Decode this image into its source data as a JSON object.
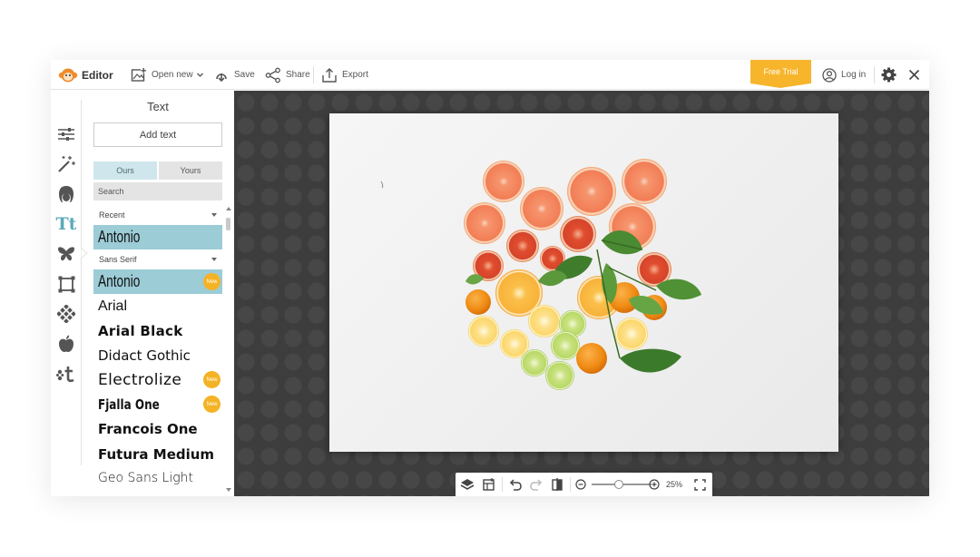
{
  "topbar": {
    "app_name": "Editor",
    "open_new": "Open new",
    "save": "Save",
    "share": "Share",
    "export": "Export",
    "free_trial": "Free Trial",
    "login": "Log in"
  },
  "rail": {
    "icons": [
      "sliders-icon",
      "magic-wand-icon",
      "face-icon",
      "text-icon",
      "butterfly-icon",
      "frame-icon",
      "texture-icon",
      "apple-icon",
      "sparkle-t-icon"
    ],
    "active": "text-icon",
    "text_glyph": "Tt"
  },
  "panel": {
    "title": "Text",
    "add_text": "Add text",
    "tabs": {
      "ours": "Ours",
      "yours": "Yours",
      "active": "Ours"
    },
    "search_placeholder": "Search",
    "recent_select": "Recent",
    "recent_fonts": [
      "Antonio"
    ],
    "category_select": "Sans Serif",
    "fonts": [
      {
        "name": "Antonio",
        "selected": true,
        "badge": "New"
      },
      {
        "name": "Arial",
        "selected": false
      },
      {
        "name": "Arial Black",
        "selected": false
      },
      {
        "name": "Didact Gothic",
        "selected": false
      },
      {
        "name": "Electrolize",
        "selected": false,
        "badge": "New"
      },
      {
        "name": "Fjalla One",
        "selected": false,
        "badge": "New"
      },
      {
        "name": "Francois One",
        "selected": false
      },
      {
        "name": "Futura Medium",
        "selected": false
      },
      {
        "name": "Geo Sans Light",
        "selected": false
      }
    ]
  },
  "zoom": {
    "value": "25%",
    "level": 0.25
  },
  "colors": {
    "accent_orange": "#f7b52c",
    "selected_font_bg": "#9cccd6",
    "canvas_bg": "#3d3d3d",
    "rail_active": "#5ba9bb"
  }
}
